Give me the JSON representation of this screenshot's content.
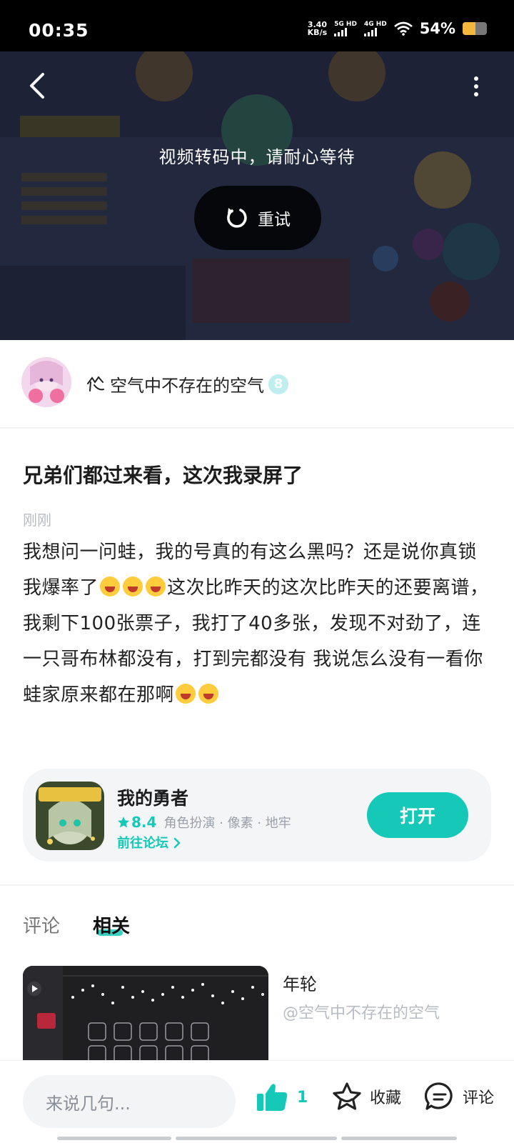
{
  "status_bar": {
    "time": "00:35",
    "net_speed_value": "3.40",
    "net_speed_unit": "KB/s",
    "sim1_label": "5G HD",
    "sim2_label": "4G HD",
    "battery_percent": "54%",
    "battery_level": 0.54,
    "battery_color": "#f4b63f"
  },
  "video": {
    "status_text": "视频转码中，请耐心等待",
    "retry_label": "重试"
  },
  "author": {
    "name": "空气中不存在的空气",
    "level": "8"
  },
  "post": {
    "title": "兄弟们都过来看，这次我录屏了",
    "time": "刚刚",
    "body_part1": "我想问一问蛙，我的号真的有这么黑吗？还是说你真锁我爆率了",
    "body_part2": "这次比昨天的这次比昨天的还要离谱，我剩下100张票子，我打了40多张，发现不对劲了，连一只哥布林都没有，打到完都没有 我说怎么没有一看你蛙家原来都在那啊"
  },
  "game_card": {
    "name": "我的勇者",
    "score": "8.4",
    "tags": "角色扮演 · 像素 · 地牢",
    "forum_link": "前往论坛",
    "open_label": "打开",
    "accent_color": "#15c8b8"
  },
  "tabs": {
    "comment": "评论",
    "related": "相关"
  },
  "related": {
    "title": "年轮",
    "author": "@空气中不存在的空气"
  },
  "bottom_bar": {
    "input_placeholder": "来说几句...",
    "like_count": "1",
    "favorite_label": "收藏",
    "comment_label": "评论"
  }
}
